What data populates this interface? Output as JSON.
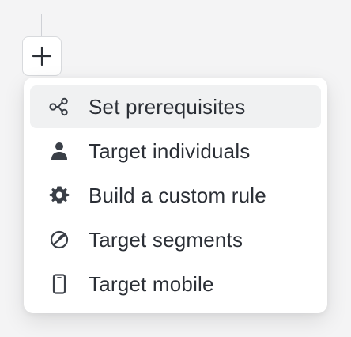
{
  "add_button": {
    "icon": "plus-icon"
  },
  "menu": {
    "items": [
      {
        "label": "Set prerequisites",
        "icon": "prerequisites-icon",
        "highlighted": true
      },
      {
        "label": "Target individuals",
        "icon": "person-icon",
        "highlighted": false
      },
      {
        "label": "Build a custom rule",
        "icon": "gear-icon",
        "highlighted": false
      },
      {
        "label": "Target segments",
        "icon": "segments-icon",
        "highlighted": false
      },
      {
        "label": "Target mobile",
        "icon": "mobile-icon",
        "highlighted": false
      }
    ]
  },
  "colors": {
    "text": "#2b2f36",
    "icon": "#3a3f47",
    "highlight": "#f0f1f2",
    "border": "#d8dadd",
    "background": "#f4f4f5"
  }
}
